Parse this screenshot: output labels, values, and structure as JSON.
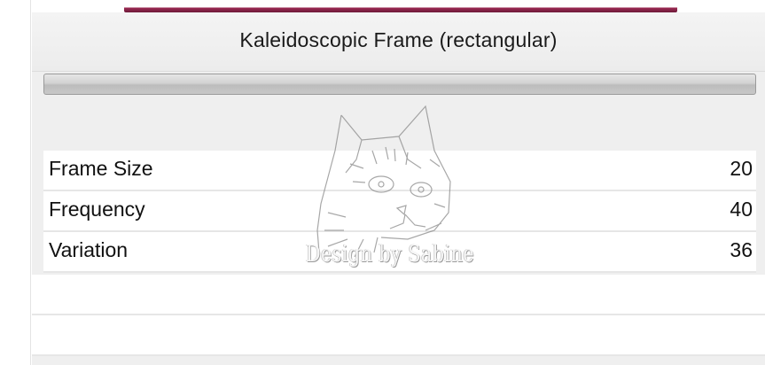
{
  "dialog": {
    "title": "Kaleidoscopic Frame (rectangular)",
    "progress_percent": 0
  },
  "parameters": [
    {
      "label": "Frame Size",
      "value": "20"
    },
    {
      "label": "Frequency",
      "value": "40"
    },
    {
      "label": "Variation",
      "value": "36"
    }
  ],
  "watermark": {
    "text": "Design by Sabine",
    "icon": "cat-sketch-icon"
  },
  "colors": {
    "top_accent": "#9b2a52",
    "panel_bg": "#efefef",
    "row_bg": "#ffffff"
  }
}
